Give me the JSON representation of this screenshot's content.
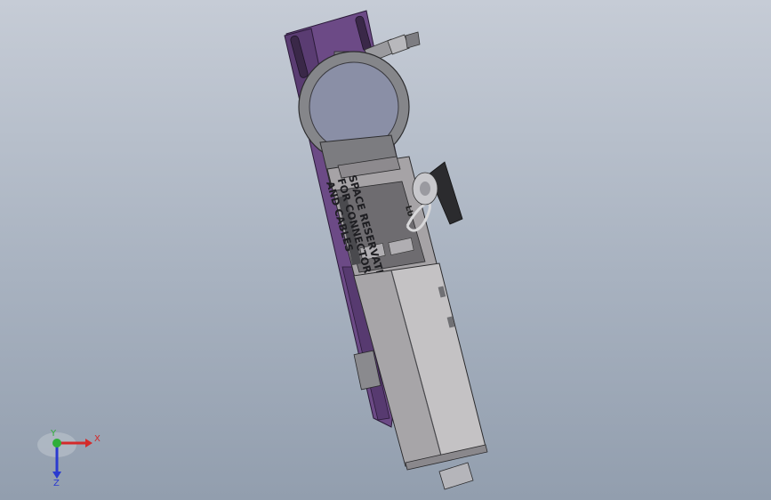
{
  "model": {
    "label_lines": [
      "SPACE RESERVATION",
      "FOR CONNECTORS",
      "AND CABLES"
    ],
    "small_label": "LU",
    "colors": {
      "bracket": "#6c4a86",
      "bracket_dark": "#4c3064",
      "housing": "#a6a3a6",
      "housing_dark": "#6e6c70",
      "ring": "#85868a",
      "disc": "#8a8fa6",
      "canister": "#c4c2c4",
      "canister_shade": "#a7a5a8"
    }
  },
  "triad": {
    "x_label": "X",
    "y_label": "Y",
    "z_label": "Z",
    "x_color": "#d42a2a",
    "y_color": "#2fae3a",
    "z_color": "#2a3ad0"
  }
}
